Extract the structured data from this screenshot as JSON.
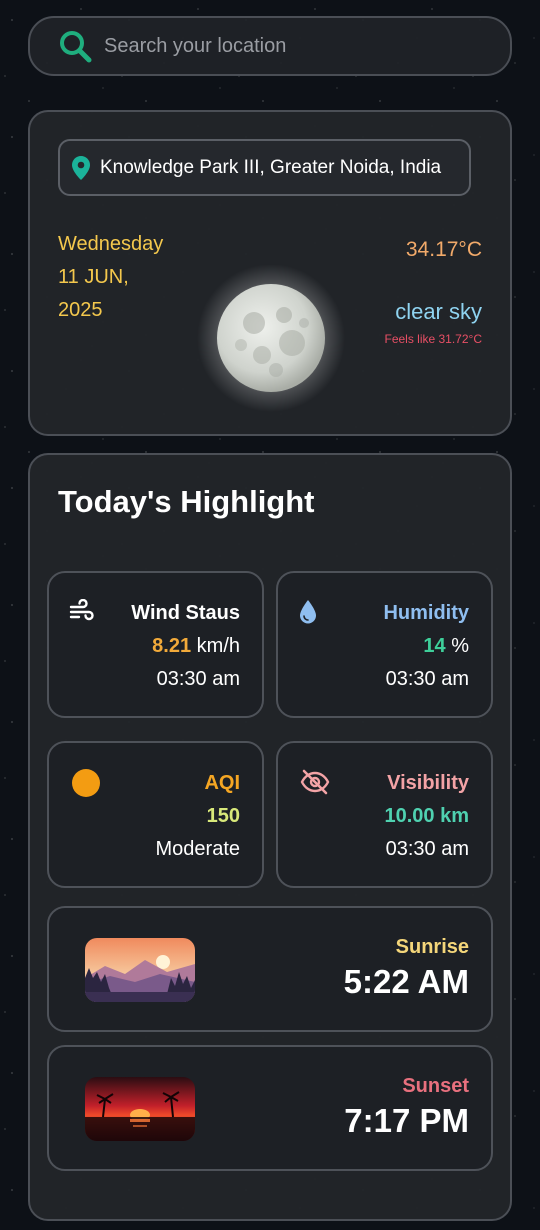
{
  "search": {
    "placeholder": "Search your location"
  },
  "location": {
    "name": "Knowledge Park III, Greater Noida, India"
  },
  "current": {
    "weekday": "Wednesday",
    "date_line1": "11 JUN,",
    "date_line2": "2025",
    "temperature": "34.17°C",
    "description": "clear sky",
    "feels_like": "Feels like 31.72°C"
  },
  "highlights": {
    "title": "Today's Highlight",
    "wind": {
      "label": "Wind Staus",
      "value": "8.21",
      "unit": "km/h",
      "time": "03:30 am"
    },
    "humidity": {
      "label": "Humidity",
      "value": "14",
      "unit": "%",
      "time": "03:30 am"
    },
    "aqi": {
      "label": "AQI",
      "value": "150",
      "status": "Moderate"
    },
    "visibility": {
      "label": "Visibility",
      "value": "10.00 km",
      "time": "03:30 am"
    },
    "sunrise": {
      "label": "Sunrise",
      "time": "5:22 AM"
    },
    "sunset": {
      "label": "Sunset",
      "time": "7:17 PM"
    }
  },
  "colors": {
    "search_icon": "#1fae7e",
    "location_pin": "#1bb39a",
    "date": "#f4c84d",
    "temperature": "#f2aa6a",
    "description": "#8fd3f0",
    "feels_like": "#e84f65",
    "wind_value": "#f2aa3a",
    "humidity_label": "#8fbef0",
    "humidity_value": "#3ecf9a",
    "aqi_label": "#f5a623",
    "aqi_value": "#d8e87a",
    "visibility_label": "#f3a3a6",
    "visibility_value": "#4fd1b0",
    "sunrise_label": "#f4d67a",
    "sunset_label": "#e8707e"
  },
  "icons": {
    "search": "search-icon",
    "location": "map-pin-icon",
    "weather": "moon-icon",
    "wind": "wind-icon",
    "humidity": "water-drop-icon",
    "aqi": "sun-circle-icon",
    "visibility": "eye-off-icon"
  }
}
